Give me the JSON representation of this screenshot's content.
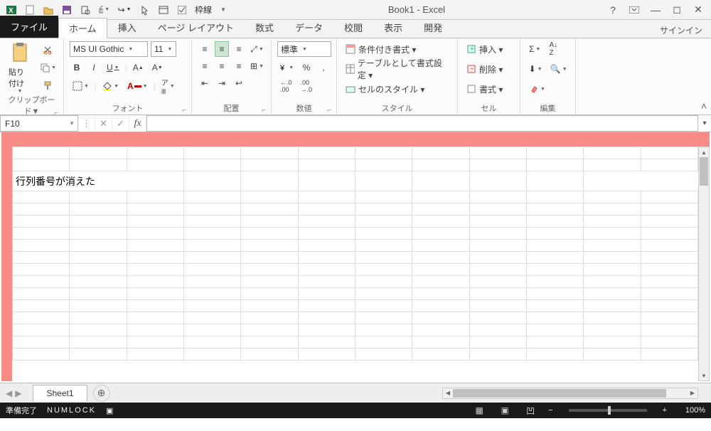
{
  "title": "Book1 - Excel",
  "qat": {
    "borders_label": "枠線"
  },
  "tabs": {
    "file": "ファイル",
    "home": "ホーム",
    "insert": "挿入",
    "pagelayout": "ページ レイアウト",
    "formulas": "数式",
    "data": "データ",
    "review": "校閲",
    "view": "表示",
    "developer": "開発",
    "signin": "サインイン"
  },
  "ribbon": {
    "clipboard": {
      "label": "クリップボード▼",
      "paste": "貼り付け"
    },
    "font": {
      "label": "フォント",
      "name": "MS UI Gothic",
      "size": "11",
      "bold": "B",
      "italic": "I",
      "underline": "U"
    },
    "align": {
      "label": "配置"
    },
    "number": {
      "label": "数値",
      "style": "標準",
      "percent": "%",
      "comma": ","
    },
    "styles": {
      "label": "スタイル",
      "cond": "条件付き書式 ▾",
      "table": "テーブルとして書式設定 ▾",
      "cell": "セルのスタイル ▾"
    },
    "cells": {
      "label": "セル",
      "insert": "挿入 ▾",
      "delete": "削除 ▾",
      "format": "書式 ▾"
    },
    "editing": {
      "label": "編集"
    }
  },
  "formula": {
    "namebox": "F10",
    "fx": "fx",
    "value": ""
  },
  "sheet": {
    "cell_text": "行列番号が消えた",
    "tab1": "Sheet1",
    "add": "⊕"
  },
  "status": {
    "ready": "準備完了",
    "numlock": "NUMLOCK",
    "zoom": "100%",
    "minus": "−",
    "plus": "+"
  }
}
